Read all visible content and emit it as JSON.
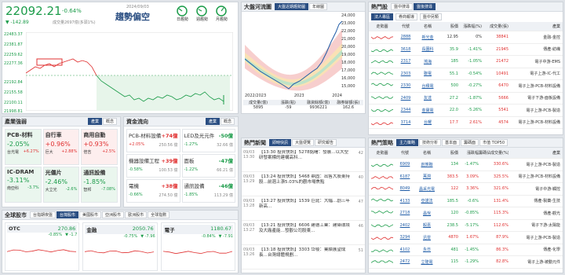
{
  "index": {
    "value": "22092.21",
    "change_pct": "-0.64%",
    "change": "▼ -142.89",
    "volume": "成交量2697億(多頭1%)",
    "date": "2024/09/03",
    "trend_label": "趨勢偏空",
    "periods": [
      "日趨勢",
      "週趨勢",
      "月趨勢"
    ],
    "y_ticks": [
      "22483.37",
      "22381.87",
      "22259.62",
      "22277.36",
      "22192.84",
      "22155.58",
      "22100.11",
      "21998.81",
      "21978.00"
    ],
    "time_ticks": [
      "09:00",
      "",
      "",
      "",
      "",
      "13:30"
    ]
  },
  "mid_chart": {
    "title": "大盤河流圖",
    "tabs": [
      "大盤近期趨勢圖",
      "年線圖"
    ],
    "y_ticks": [
      "24,000",
      "23,000",
      "22,000",
      "21,000",
      "20,000",
      "19,000",
      "18,000",
      "17,000",
      "16,000",
      "15,000",
      "14,000"
    ],
    "x_ticks": [
      "2022/2023",
      "2023",
      "2024"
    ],
    "table_headers": [
      "成交量(億)",
      "漲跌(點)",
      "融資餘額(億)",
      "融券餘額(張)"
    ],
    "table_values": [
      "5895",
      "-59",
      "9936221",
      "162.6"
    ],
    "note": "成交量：2024/9"
  },
  "hot_stocks": {
    "title": "熱門股",
    "top_tabs": [
      "盤中搜尋",
      "盤後搜尋"
    ],
    "sub_tabs": [
      "法人專區",
      "券商報導",
      "盤中另類"
    ],
    "headers": [
      "走勢圖",
      "代號",
      "名稱",
      "股價",
      "漲跌幅(%)",
      "成交量(張)",
      "產業"
    ],
    "rows": [
      {
        "code": "2888",
        "name": "新光金",
        "price": "12.95",
        "pct": "0%",
        "vol": "38841",
        "ind": "金融-金控",
        "c": "dk"
      },
      {
        "code": "3618",
        "name": "長園科",
        "price": "35.9",
        "pct": "-1.41%",
        "vol": "21945",
        "ind": "傳產-紡織",
        "c": "dn"
      },
      {
        "code": "2317",
        "name": "鴻海",
        "price": "185",
        "pct": "-1.05%",
        "vol": "21472",
        "ind": "電子中游-EMS",
        "c": "dn"
      },
      {
        "code": "2303",
        "name": "聯電",
        "price": "55.1",
        "pct": "-0.54%",
        "vol": "10491",
        "ind": "電子上游-IC-代工",
        "c": "dn"
      },
      {
        "code": "2330",
        "name": "台積電",
        "price": "500",
        "pct": "-0.27%",
        "vol": "6470",
        "ind": "電子上游-PCB-材料設備",
        "c": "dn"
      },
      {
        "code": "2409",
        "name": "友達",
        "price": "27.2",
        "pct": "-1.87%",
        "vol": "5666",
        "ind": "電子下游-面板設備",
        "c": "dn"
      },
      {
        "code": "2344",
        "name": "金寶電",
        "price": "22.0",
        "pct": "-5.26%",
        "vol": "5541",
        "ind": "電子上游-PCB-製造",
        "c": "dn"
      },
      {
        "code": "3714",
        "name": "台耀",
        "price": "17.7",
        "pct": "2.61%",
        "vol": "4574",
        "ind": "電子上游-PCB-材料設備",
        "c": "up"
      }
    ]
  },
  "industry": {
    "title": "產業強弱",
    "tabs": [
      "產業",
      "概念"
    ],
    "items": [
      {
        "name": "PCB-材料",
        "pct": "-2.05%",
        "c": "dn",
        "s1": "台光電",
        "p1": "+6.27%",
        "c1": "up"
      },
      {
        "name": "自行車",
        "pct": "+0.96%",
        "c": "up",
        "s1": "巨大",
        "p1": "+2.88%",
        "c1": "up"
      },
      {
        "name": "商用自動",
        "pct": "+0.93%",
        "c": "up",
        "s1": "倍吉",
        "p1": "+2.5%",
        "c1": "up"
      },
      {
        "name": "IC-DRAM",
        "pct": "-3.11%",
        "c": "dn",
        "s1": "南亞科",
        "p1": "-3.7%",
        "c1": "dn"
      },
      {
        "name": "光儀片",
        "pct": "-2.46%",
        "c": "dn",
        "s1": "大立光",
        "p1": "-2.6%",
        "c1": "dn"
      },
      {
        "name": "通訊設備",
        "pct": "-1.85%",
        "c": "dn",
        "s1": "智邦",
        "p1": "-7.08%",
        "c1": "dn"
      }
    ]
  },
  "flow": {
    "title": "資金流向",
    "tabs": [
      "產業",
      "概念"
    ],
    "items": [
      {
        "name": "PCB-材料設備",
        "amt": "+74億",
        "c": "up",
        "a": "+2.05%",
        "b": "250.56 億"
      },
      {
        "name": "LED及光元件",
        "amt": "-50億",
        "c": "dn",
        "a": "-1.27%",
        "b": "32.66 億"
      },
      {
        "name": "機器設備工程",
        "amt": "+39億",
        "c": "up",
        "a": "-0.58%",
        "b": "100.53 億"
      },
      {
        "name": "面板",
        "amt": "-47億",
        "c": "dn",
        "a": "-1.22%",
        "b": "66.21 億"
      },
      {
        "name": "電機",
        "amt": "+38億",
        "c": "up",
        "a": "-0.66%",
        "b": "274.50 億"
      },
      {
        "name": "通訊設備",
        "amt": "-46億",
        "c": "dn",
        "a": "-1.85%",
        "b": "113.29 億"
      }
    ]
  },
  "global": {
    "title": "全球股市",
    "tabs": [
      "台指期夜盤",
      "台灣股市",
      "美國股市",
      "亞洲股市",
      "歐洲股市",
      "全球指數"
    ],
    "cards": [
      {
        "name": "OTC",
        "value": "270.86",
        "chg": "-0.85%",
        "chg2": "▼ -1.7",
        "c": "dn"
      },
      {
        "name": "金融",
        "value": "2050.76",
        "chg": "-0.75%",
        "chg2": "▼ -7.96",
        "c": "dn"
      },
      {
        "name": "電子",
        "value": "1180.67",
        "chg": "-0.84%",
        "chg2": "▼ -7.91",
        "c": "dn"
      }
    ]
  },
  "news": {
    "title": "熱門新聞",
    "tabs": [
      "即時快訊",
      "大盤便覽",
      "研究報告"
    ],
    "items": [
      {
        "date": "09/03",
        "time": "13:30",
        "text": "【13:30 投資快訊】5278銘曙：發展…以大型研發案標的建構高科…",
        "n": "42"
      },
      {
        "date": "09/03",
        "time": "13:29",
        "text": "【13:24 投資快訊】5468 鼎固：出售大股東持股…前週上漲5.03%的觀市場焦點",
        "n": "40"
      },
      {
        "date": "09/03",
        "time": "13:28",
        "text": "【13:27 投資快訊】1539 巨庭：大幅…創三年新高…",
        "n": "47"
      },
      {
        "date": "09/03",
        "time": "13:27",
        "text": "【13:21 投資快訊】6606 建德工業：建築環境及大廠產能…發觀公司股東…",
        "n": "46"
      },
      {
        "date": "09/03",
        "time": "13:26",
        "text": "【13:18 投資快訊】3303 岱稜：業績展望成長…台灣總體規劃…",
        "n": "51"
      }
    ]
  },
  "hot_strategy": {
    "title": "熱門策略",
    "tabs": [
      "主力策略",
      "技術分析",
      "基本面",
      "籌碼面",
      "市值 TOP50"
    ],
    "headers": [
      "走勢圖",
      "代號",
      "名稱",
      "股價",
      "漲跌幅",
      "籌碼佔成交量(%)",
      "產業"
    ],
    "rows": [
      {
        "code": "6909",
        "name": "創惟聯",
        "price": "134",
        "pct": "-1.47%",
        "ratio": "330.6%",
        "ind": "電子上游-PCB-製造",
        "c": "dn"
      },
      {
        "code": "6187",
        "name": "萬潤",
        "price": "383.5",
        "pct": "3.09%",
        "ratio": "325.5%",
        "ind": "電子上游-PCB-材料設備",
        "c": "up"
      },
      {
        "code": "8049",
        "name": "晶采光電",
        "price": "122",
        "pct": "3.36%",
        "ratio": "321.6%",
        "ind": "電子中游-觸控",
        "c": "up"
      },
      {
        "code": "4133",
        "name": "亞諾法",
        "price": "185.5",
        "pct": "-0.6%",
        "ratio": "131.4%",
        "ind": "傳產-製藥-生技",
        "c": "dn"
      },
      {
        "code": "2718",
        "name": "晶悅",
        "price": "120",
        "pct": "-0.85%",
        "ratio": "115.3%",
        "ind": "傳產-觀光",
        "c": "dn"
      },
      {
        "code": "2402",
        "name": "毅嘉",
        "price": "238.5",
        "pct": "-5.17%",
        "ratio": "112.6%",
        "ind": "電子下游-太陽能",
        "c": "dn"
      },
      {
        "code": "3294",
        "name": "迅雷",
        "price": "4870",
        "pct": "1.67%",
        "ratio": "87.9%",
        "ind": "電子上游-PCB-製造",
        "c": "up"
      },
      {
        "code": "4102",
        "name": "永日",
        "price": "481",
        "pct": "-1.45%",
        "ratio": "86.3%",
        "ind": "傳產-化學",
        "c": "dn"
      },
      {
        "code": "2472",
        "name": "立隆電",
        "price": "115",
        "pct": "-1.29%",
        "ratio": "82.8%",
        "ind": "電子上游-被動元件",
        "c": "dn"
      }
    ]
  }
}
